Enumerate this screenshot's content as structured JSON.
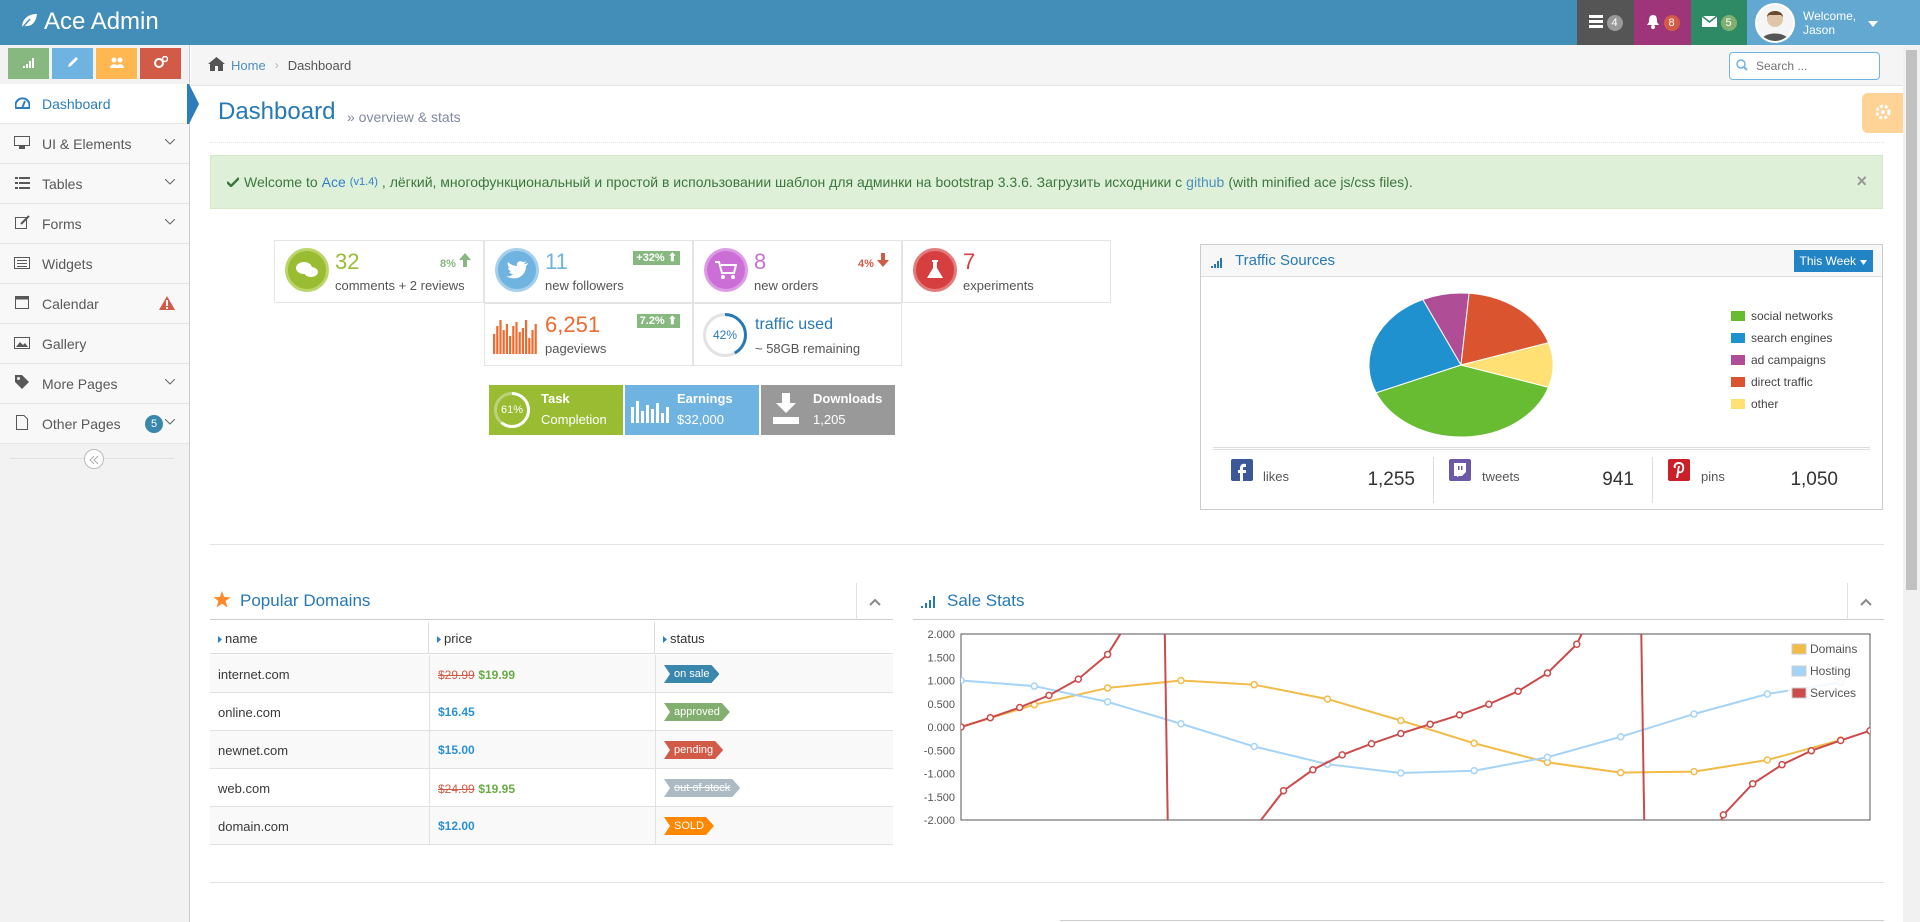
{
  "navbar": {
    "brand": "Ace Admin",
    "tasks_count": "4",
    "notifications_count": "8",
    "messages_count": "5",
    "welcome": "Welcome,",
    "user_name": "Jason"
  },
  "sidebar": {
    "shortcuts": [
      "signal-icon",
      "pencil-icon",
      "users-icon",
      "cogs-icon"
    ],
    "items": [
      {
        "label": "Dashboard",
        "icon": "dashboard-icon"
      },
      {
        "label": "UI & Elements",
        "icon": "desktop-icon"
      },
      {
        "label": "Tables",
        "icon": "list-icon"
      },
      {
        "label": "Forms",
        "icon": "edit-icon"
      },
      {
        "label": "Widgets",
        "icon": "list-alt-icon"
      },
      {
        "label": "Calendar",
        "icon": "calendar-icon"
      },
      {
        "label": "Gallery",
        "icon": "picture-icon"
      },
      {
        "label": "More Pages",
        "icon": "tag-icon"
      },
      {
        "label": "Other Pages",
        "icon": "file-icon",
        "badge": "5"
      }
    ]
  },
  "breadcrumb": {
    "home": "Home",
    "current": "Dashboard",
    "search_placeholder": "Search ..."
  },
  "page": {
    "title": "Dashboard",
    "subtitle": "» overview & stats"
  },
  "alert": {
    "welcome_to": "Welcome to",
    "product": "Ace",
    "version": "(v1.4)",
    "text": ", лёгкий, многофункциональный и простой в использовании шаблон для админки на",
    "bootstrap": "bootstrap 3.3.6",
    "download_text": ". Загрузить исходники с",
    "github": "github",
    "tail": "(with minified ace js/css files)."
  },
  "infoboxes": [
    {
      "number": "32",
      "text": "comments + 2 reviews",
      "right": "8%",
      "color": "#9abc32"
    },
    {
      "number": "11",
      "text": "new followers",
      "right": "+32%",
      "color": "#6fb3e0"
    },
    {
      "number": "8",
      "text": "new orders",
      "right": "4%",
      "color": "#cb6fd7"
    },
    {
      "number": "7",
      "text": "experiments",
      "right": "",
      "color": "#d53f40"
    },
    {
      "number": "6,251",
      "text": "pageviews",
      "right": "7.2%",
      "color": "#e8b110"
    },
    {
      "number": "traffic used",
      "text": "~ 58GB remaining",
      "progress_label": "42%",
      "progress": 0.42,
      "color": "#2679b5"
    }
  ],
  "small_boxes": [
    {
      "title": "Task",
      "subtitle": "Completion",
      "progress_label": "61%",
      "progress": 0.61,
      "color": "#9abc32"
    },
    {
      "title": "Earnings",
      "subtitle": "$32,000",
      "color": "#6fb3e0"
    },
    {
      "title": "Downloads",
      "subtitle": "1,205",
      "color": "#999999"
    }
  ],
  "traffic": {
    "title": "Traffic Sources",
    "period": "This Week",
    "pie": [
      {
        "label": "social networks",
        "value": 38.7,
        "color": "#68bc31"
      },
      {
        "label": "search engines",
        "value": 24.5,
        "color": "#2091cf"
      },
      {
        "label": "ad campaigns",
        "value": 8.2,
        "color": "#af4e96"
      },
      {
        "label": "direct traffic",
        "value": 18.6,
        "color": "#da5430"
      },
      {
        "label": "other",
        "value": 10,
        "color": "#fee074"
      }
    ],
    "social": [
      {
        "label": "likes",
        "count": "1,255",
        "color": "#3b5998",
        "icon": "facebook-icon"
      },
      {
        "label": "tweets",
        "count": "941",
        "color": "#6d5aa7",
        "icon": "twitter-icon"
      },
      {
        "label": "pins",
        "count": "1,050",
        "color": "#cb2027",
        "icon": "pinterest-icon"
      }
    ]
  },
  "domains": {
    "title": "Popular Domains",
    "headers": [
      "name",
      "price",
      "status"
    ],
    "rows": [
      {
        "name": "internet.com",
        "old_price": "$29.99",
        "price": "$19.99",
        "status": "on sale",
        "status_color": "#3a87ad"
      },
      {
        "name": "online.com",
        "old_price": "",
        "price": "$16.45",
        "status": "approved",
        "status_color": "#82af6f"
      },
      {
        "name": "newnet.com",
        "old_price": "",
        "price": "$15.00",
        "status": "pending",
        "status_color": "#d15b47"
      },
      {
        "name": "web.com",
        "old_price": "$24.99",
        "price": "$19.95",
        "status": "out of stock",
        "status_color": "#abbac3"
      },
      {
        "name": "domain.com",
        "old_price": "",
        "price": "$12.00",
        "status": "SOLD",
        "status_color": "#ff8800"
      }
    ]
  },
  "sale_stats": {
    "title": "Sale Stats"
  },
  "chart_data": {
    "type": "line",
    "title": "",
    "xlim": [
      0,
      6.2
    ],
    "ylim": [
      -2,
      2
    ],
    "xticks": [
      "0.0",
      "0.5",
      "1.0",
      "1.5",
      "2.0",
      "2.5",
      "3.0",
      "3.5",
      "4.0",
      "4.5",
      "5.0",
      "5.5",
      "6.0"
    ],
    "yticks": [
      "2.000",
      "1.500",
      "1.000",
      "0.500",
      "0.000",
      "-0.500",
      "-1.000",
      "-1.500",
      "-2.000"
    ],
    "legend_position": "top-right",
    "series": [
      {
        "name": "Domains",
        "color": "#f2bb46",
        "x": [
          0,
          0.5,
          1.0,
          1.5,
          2.0,
          2.5,
          3.0,
          3.5,
          4.0,
          4.5,
          5.0,
          5.5,
          6.0
        ],
        "y": [
          0,
          0.48,
          0.84,
          1.0,
          0.91,
          0.6,
          0.14,
          -0.35,
          -0.76,
          -0.98,
          -0.96,
          -0.71,
          -0.28
        ]
      },
      {
        "name": "Hosting",
        "color": "#a6d4f8",
        "x": [
          0,
          0.5,
          1.0,
          1.5,
          2.0,
          2.5,
          3.0,
          3.5,
          4.0,
          4.5,
          5.0,
          5.5,
          6.0
        ],
        "y": [
          1.0,
          0.88,
          0.54,
          0.07,
          -0.42,
          -0.8,
          -0.99,
          -0.94,
          -0.65,
          -0.21,
          0.28,
          0.71,
          0.96
        ]
      },
      {
        "name": "Services",
        "color": "#cb4b4b",
        "x": [
          0,
          0.2,
          0.4,
          0.6,
          0.8,
          1.0,
          1.2,
          1.4,
          2.0,
          2.2,
          2.4,
          2.6,
          2.8,
          3.0,
          3.2,
          3.4,
          3.6,
          3.8,
          4.0,
          4.2,
          4.4,
          4.6,
          5.0,
          5.2,
          5.4,
          5.6,
          5.8,
          6.0,
          6.2
        ],
        "y": [
          0,
          0.2,
          0.42,
          0.68,
          1.03,
          1.56,
          2.57,
          5.8,
          -2.19,
          -1.37,
          -0.92,
          -0.6,
          -0.36,
          -0.14,
          0.06,
          0.26,
          0.49,
          0.77,
          1.16,
          1.78,
          3.1,
          8.86,
          -3.38,
          -1.89,
          -1.22,
          -0.81,
          -0.51,
          -0.29,
          -0.08
        ]
      }
    ]
  }
}
